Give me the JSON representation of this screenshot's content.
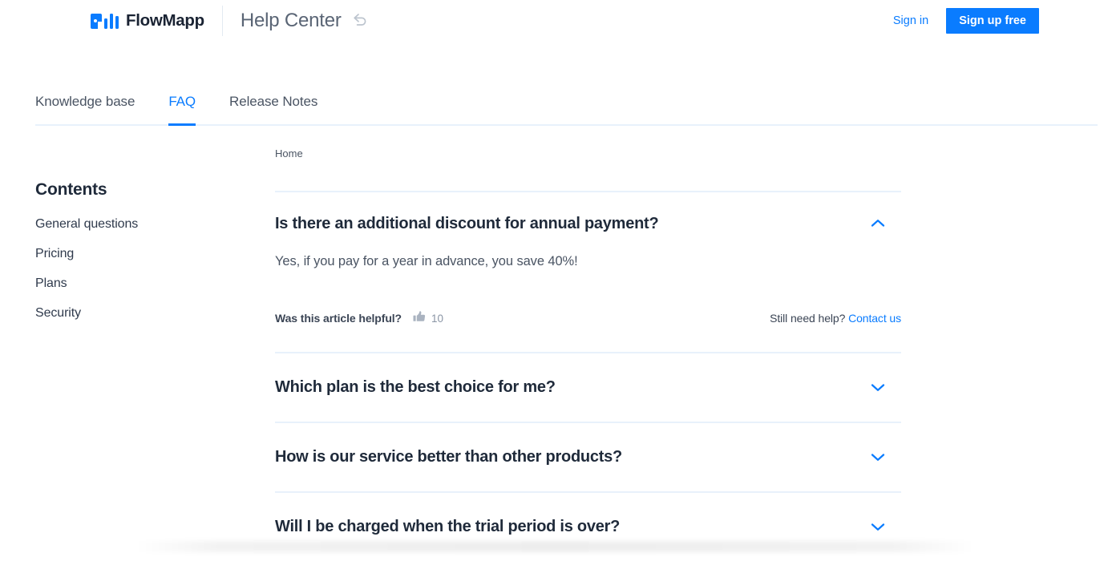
{
  "header": {
    "logo_text": "FlowMapp",
    "logo_icon": "flowmapp-logo-icon",
    "app_title": "Help Center",
    "undo_icon": "undo-arrow-icon",
    "signin_label": "Sign in",
    "signup_label": "Sign up free",
    "accent_color": "#0a7cff"
  },
  "tabs": [
    {
      "label": "Knowledge base",
      "active": false
    },
    {
      "label": "FAQ",
      "active": true
    },
    {
      "label": "Release Notes",
      "active": false
    }
  ],
  "sidebar": {
    "title": "Contents",
    "items": [
      {
        "label": "General questions"
      },
      {
        "label": "Pricing"
      },
      {
        "label": "Plans"
      },
      {
        "label": "Security"
      }
    ]
  },
  "main": {
    "breadcrumb": "Home",
    "faqs": [
      {
        "question": "Is there an additional discount for annual payment?",
        "answer": "Yes, if you pay for a year in advance, you save 40%!",
        "expanded": true,
        "chevron_icon": "chevron-up-icon",
        "helpful_label": "Was this article helpful?",
        "thumb_icon": "thumbs-up-icon",
        "thumb_count": "10",
        "need_help_text": "Still need help?",
        "contact_label": "Contact us"
      },
      {
        "question": "Which plan is the best choice for me?",
        "expanded": false,
        "chevron_icon": "chevron-down-icon"
      },
      {
        "question": "How is our service better than other products?",
        "expanded": false,
        "chevron_icon": "chevron-down-icon"
      },
      {
        "question": "Will I be charged when the trial period is over?",
        "expanded": false,
        "chevron_icon": "chevron-down-icon"
      }
    ]
  },
  "colors": {
    "accent": "#0a7cff",
    "divider": "#e8f1fb",
    "heading": "#1f2a3a",
    "body": "#4a5463",
    "muted": "#8a95a5"
  }
}
